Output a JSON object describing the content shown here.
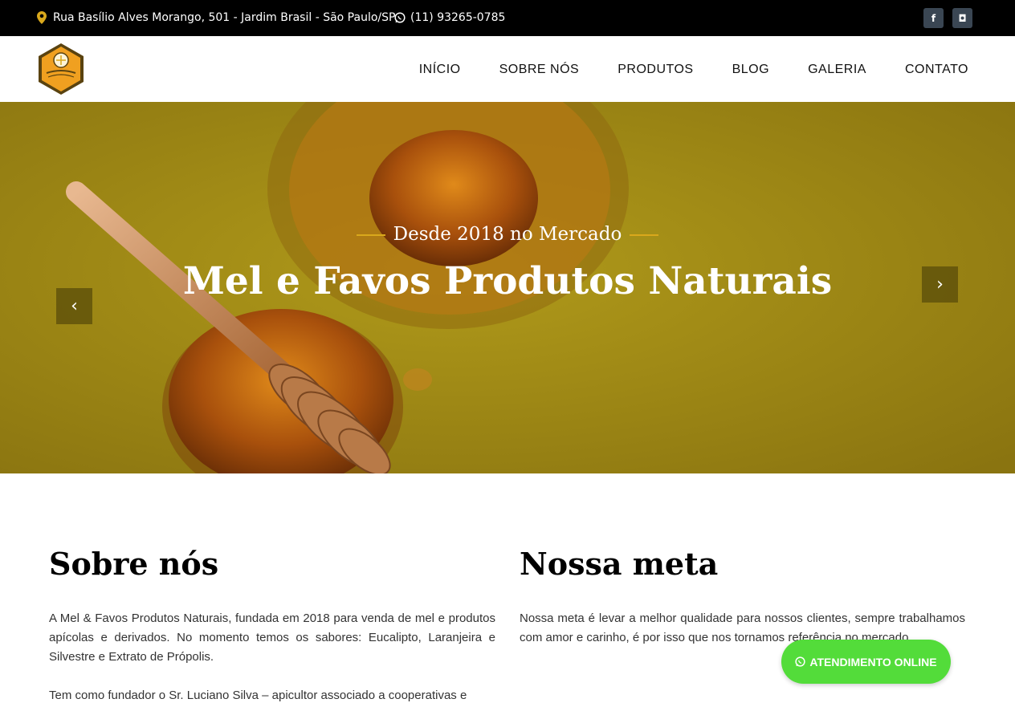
{
  "topbar": {
    "address": "Rua Basílio Alves Morango, 501 - Jardim Brasil - São Paulo/SP",
    "phone": "(11) 93265-0785",
    "facebook_glyph": "f",
    "instagram_glyph": "◘"
  },
  "nav": {
    "items": [
      "INÍCIO",
      "SOBRE NÓS",
      "PRODUTOS",
      "BLOG",
      "GALERIA",
      "CONTATO"
    ]
  },
  "hero": {
    "subtitle": "Desde 2018 no Mercado",
    "title": "Mel e Favos Produtos Naturais",
    "prev": "‹",
    "next": "›"
  },
  "about": {
    "heading": "Sobre nós",
    "p1": "A Mel & Favos Produtos Naturais, fundada em 2018 para venda de mel e produtos apícolas e derivados. No momento temos os sabores: Eucalipto, Laranjeira e Silvestre e Extrato de Própolis.",
    "p2": "Tem como fundador o Sr. Luciano Silva – apicultor associado a cooperativas e"
  },
  "goal": {
    "heading": "Nossa meta",
    "p1": "Nossa meta é levar a melhor qualidade para nossos clientes, sempre trabalhamos com amor e carinho, é por isso que nos tornamos referência no mercado."
  },
  "whatsapp": {
    "label": "ATENDIMENTO ONLINE"
  },
  "colors": {
    "accent": "#d9a81c",
    "hero_bg": "#9c8412",
    "whatsapp": "#53dc3a"
  }
}
